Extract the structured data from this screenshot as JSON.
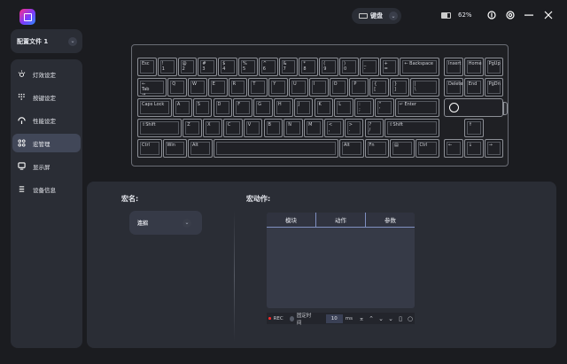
{
  "app": {
    "profile": "配置文件 1",
    "device_select": "键盘",
    "battery_percent": "62%",
    "battery_level": 0.62
  },
  "nav": [
    {
      "label": "灯效设定",
      "icon": "light-icon"
    },
    {
      "label": "按键设定",
      "icon": "keypad-icon"
    },
    {
      "label": "性能设定",
      "icon": "performance-icon"
    },
    {
      "label": "宏管理",
      "icon": "macro-icon",
      "active": true
    },
    {
      "label": "显示屏",
      "icon": "display-icon"
    },
    {
      "label": "设备信息",
      "icon": "list-icon"
    }
  ],
  "keyboard": {
    "rows": [
      [
        "Esc",
        "!\n1",
        "@\n2",
        "#\n3",
        "$\n4",
        "%\n5",
        "^\n6",
        "&\n7",
        "*\n8",
        "(\n9",
        ")\n0",
        "_\n-",
        "+\n=",
        "← Backspace"
      ],
      [
        "←\nTab\n→",
        "Q",
        "W",
        "E",
        "R",
        "T",
        "Y",
        "U",
        "I",
        "O",
        "P",
        "{\n[",
        "}\n]",
        "|\n\\"
      ],
      [
        "Caps Lock",
        "A",
        "S",
        "D",
        "F",
        "G",
        "H",
        "J",
        "K",
        "L",
        ":\n;",
        "\"\n'",
        "↵ Enter"
      ],
      [
        "⇧Shift",
        "Z",
        "X",
        "C",
        "V",
        "B",
        "N",
        "M",
        "<\n,",
        ">\n.",
        "?\n/",
        "⇧Shift"
      ],
      [
        "Ctrl",
        "Win",
        "Alt",
        "",
        "Alt",
        "Fn",
        "▤",
        "Ctrl"
      ]
    ],
    "nav_cluster": [
      [
        "Insert",
        "Home",
        "PgUp"
      ],
      [
        "Delete",
        "End",
        "PgDn"
      ]
    ],
    "arrows": {
      "up": "↑",
      "left": "←",
      "down": "↓",
      "right": "→"
    }
  },
  "macro": {
    "name_label": "宏名:",
    "name_value": "连招",
    "actions_label": "宏动作:",
    "columns": [
      "模块",
      "动作",
      "参数"
    ],
    "rows": [],
    "toolbar": {
      "rec": "REC",
      "fixed_time": "固定时间",
      "delay_value": "10",
      "unit": "ms",
      "icons": [
        "collapse-icon",
        "move-up-icon",
        "move-down-icon",
        "expand-icon",
        "delete-icon",
        "clear-icon"
      ]
    }
  }
}
